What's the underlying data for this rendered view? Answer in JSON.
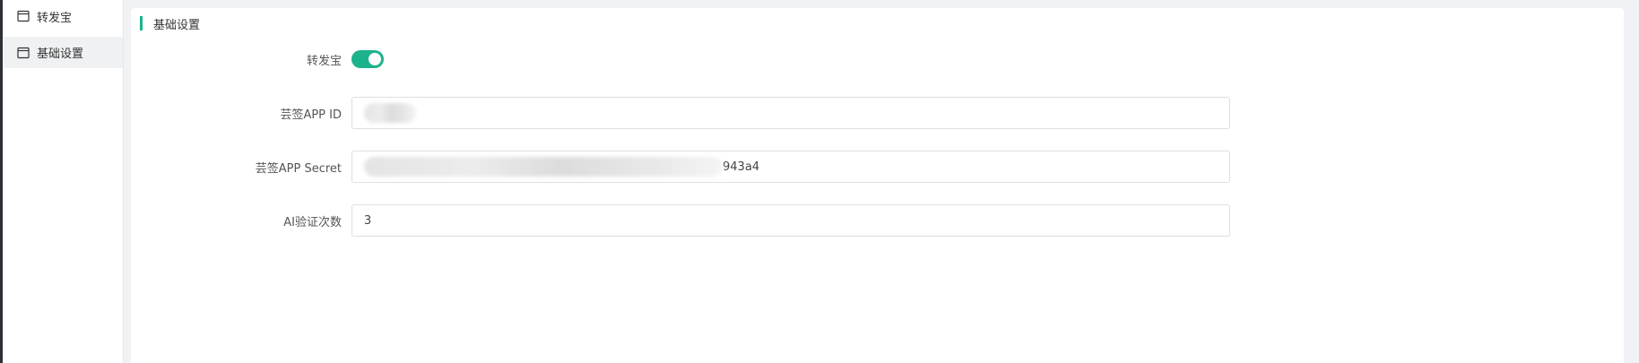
{
  "sidebar": {
    "items": [
      {
        "label": "转发宝",
        "icon": "window-icon",
        "active": false
      },
      {
        "label": "基础设置",
        "icon": "window-icon",
        "active": true
      }
    ]
  },
  "card": {
    "title": "基础设置"
  },
  "form": {
    "toggle": {
      "label": "转发宝",
      "enabled": true
    },
    "app_id": {
      "label": "芸签APP ID",
      "value": ""
    },
    "app_secret": {
      "label": "芸签APP Secret",
      "visible_suffix": "943a4"
    },
    "ai_verify_count": {
      "label": "AI验证次数",
      "value": "3"
    }
  },
  "colors": {
    "accent": "#1cb38c",
    "sidebar_active_bg": "#eff1f3",
    "content_bg": "#f0f2f5",
    "input_border": "#dcdfe6"
  }
}
